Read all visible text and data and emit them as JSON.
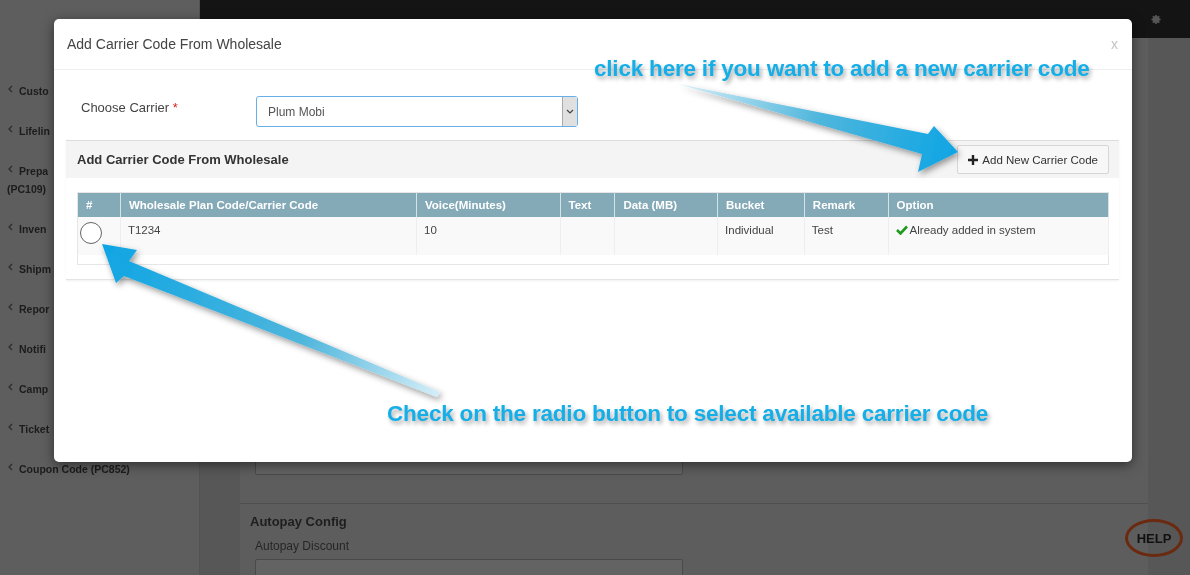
{
  "background": {
    "sidebar": {
      "items": [
        {
          "lines": [
            "Custo"
          ]
        },
        {
          "lines": [
            "Lifelin"
          ]
        },
        {
          "lines": [
            "Prepa",
            "(PC109)"
          ]
        },
        {
          "lines": [
            "Inven"
          ]
        },
        {
          "lines": [
            "Shipm"
          ]
        },
        {
          "lines": [
            "Repor"
          ]
        },
        {
          "lines": [
            "Notifi"
          ]
        },
        {
          "lines": [
            "Camp"
          ]
        },
        {
          "lines": [
            "Ticket"
          ]
        },
        {
          "lines": [
            "Coupon Code (PC852)"
          ]
        }
      ]
    },
    "content": {
      "section_title": "Autopay Config",
      "field_label": "Autopay Discount"
    },
    "help_badge": "HELP"
  },
  "modal": {
    "title": "Add Carrier Code From Wholesale",
    "close": "x",
    "form": {
      "label": "Choose Carrier",
      "required_mark": "*",
      "select_value": "Plum Mobi"
    },
    "panel": {
      "title": "Add Carrier Code From Wholesale",
      "add_button": "Add New Carrier Code",
      "table": {
        "columns": [
          "#",
          "Wholesale Plan Code/Carrier Code",
          "Voice(Minutes)",
          "Text",
          "Data (MB)",
          "Bucket",
          "Remark",
          "Option"
        ],
        "rows": [
          {
            "selected": false,
            "cells": [
              "",
              "T1234",
              "10",
              "",
              "",
              "Individual",
              "Test",
              "Already added in system"
            ]
          }
        ]
      }
    }
  },
  "annotations": [
    {
      "kind": "top",
      "text": "click here if you want to add a new carrier code"
    },
    {
      "kind": "bottom",
      "text": "Check on the radio button to select available carrier code"
    }
  ]
}
